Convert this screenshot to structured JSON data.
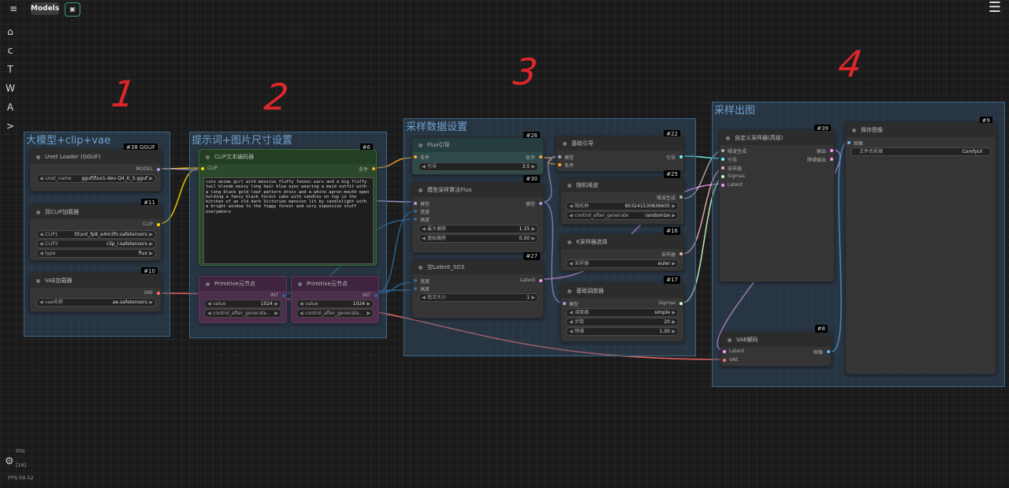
{
  "topbar": {
    "menu_label": "≡",
    "models_label": "Models",
    "queue_icon": "save-icon",
    "hamburger": "☰"
  },
  "sidebar": [
    {
      "name": "home-icon",
      "glyph": "⌂"
    },
    {
      "name": "sidebar-item-c",
      "glyph": "c"
    },
    {
      "name": "sidebar-item-t",
      "glyph": "T"
    },
    {
      "name": "sidebar-item-w",
      "glyph": "W"
    },
    {
      "name": "sidebar-item-a",
      "glyph": "A"
    },
    {
      "name": "sidebar-item-expand",
      "glyph": ">"
    }
  ],
  "annotations": [
    "1",
    "2",
    "3",
    "4"
  ],
  "groups": {
    "g1": "大模型+clip+vae",
    "g2": "提示词+图片尺寸设置",
    "g3": "采样数据设置",
    "g4": "采样出图"
  },
  "nodes": {
    "unet": {
      "title": "Unet Loader (GGUF)",
      "badge": "#38 GGUF",
      "out": "MODEL",
      "w_label": "unet_name",
      "w_value": "gguf\\flux1-dev-Q4_K_S.gguf"
    },
    "dualclip": {
      "title": "双CLIP加载器",
      "badge": "#11",
      "out": "CLIP",
      "w1_label": "CLIP1",
      "w1_value": "t5\\xxl_fp8_e4m3fn.safetensors",
      "w2_label": "CLIP2",
      "w2_value": "clip_l.safetensors",
      "w3_label": "type",
      "w3_value": "flux"
    },
    "vae": {
      "title": "VAE加载器",
      "badge": "#10",
      "out": "VAE",
      "w_label": "vae名称",
      "w_value": "ae.safetensors"
    },
    "clipenc": {
      "title": "CLIP文本编码器",
      "badge": "#6",
      "in": "CLIP",
      "out": "条件",
      "text": "cute anime girl with massive fluffy fennec ears and a big fluffy tail blonde messy long hair blue eyes wearing a maid outfit with a long black gold leaf pattern dress and a white apron mouth open holding a fancy black forest cake with candles on top in the kitchen of an old dark Victorian mansion lit by candlelight with a bright window to the foggy forest and very expensive stuff everywhere"
    },
    "prim1": {
      "title": "Primitive元节点",
      "out": "INT",
      "w1_label": "value",
      "w1_value": "1024",
      "w2_label": "control_after_generate..",
      "w2_value": ""
    },
    "prim2": {
      "title": "Primitive元节点",
      "out": "INT",
      "w1_label": "value",
      "w1_value": "1024",
      "w2_label": "control_after_generate..",
      "w2_value": ""
    },
    "fluxguide": {
      "title": "Flux引导",
      "badge": "#26",
      "in": "条件",
      "out": "条件",
      "w_label": "引导",
      "w_value": "3.5"
    },
    "modelsamp": {
      "title": "模型采样算法Flux",
      "badge": "#30",
      "in1": "模型",
      "in2": "宽度",
      "in3": "高度",
      "out": "模型",
      "w1_label": "最大偏移",
      "w1_value": "1.15",
      "w2_label": "基础偏移",
      "w2_value": "0.50"
    },
    "latent": {
      "title": "空Latent_SD3",
      "badge": "#27",
      "in1": "宽度",
      "in2": "高度",
      "out": "Latent",
      "w_label": "批次大小",
      "w_value": "1"
    },
    "basicguide": {
      "title": "基础引导",
      "badge": "#22",
      "in1": "模型",
      "in2": "条件",
      "out": "引导"
    },
    "noise": {
      "title": "随机噪波",
      "badge": "#25",
      "out": "噪波生成",
      "w1_label": "随机种",
      "w1_value": "803241530836605",
      "w2_label": "control_after_generate",
      "w2_value": "randomize"
    },
    "ksel": {
      "title": "K采样器选择",
      "badge": "#16",
      "out": "采样器",
      "w_label": "采样器",
      "w_value": "euler"
    },
    "sched": {
      "title": "基础调度器",
      "badge": "#17",
      "in": "模型",
      "out": "Sigmas",
      "w1_label": "调度器",
      "w1_value": "simple",
      "w2_label": "步数",
      "w2_value": "20",
      "w3_label": "降噪",
      "w3_value": "1.00"
    },
    "custsamp": {
      "title": "自定义采样器(高级)",
      "badge": "#39",
      "in1": "噪波生成",
      "in2": "引导",
      "in3": "采样器",
      "in4": "Sigmas",
      "in5": "Latent",
      "out1": "输出",
      "out2": "降噪输出"
    },
    "vaedec": {
      "title": "VAE解码",
      "badge": "#8",
      "in1": "Latent",
      "in2": "VAE",
      "out": "图像"
    },
    "save": {
      "title": "保存图像",
      "badge": "#9",
      "in": "图像",
      "w_label": "文件名前缀",
      "w_value": "ComfyUI"
    }
  },
  "footer": {
    "line1": "00s",
    "line2": "[16]",
    "fps": "FPS:59.52"
  },
  "colors": {
    "model": "#b39ddb",
    "clip": "#ffd500",
    "vae": "#ff6e6e",
    "conditioning": "#ffa931",
    "latent": "#ff9cf9",
    "int": "#29699c",
    "image": "#64b5f6",
    "sampler": "#ecb4b4",
    "sigmas": "#cdffcd",
    "guider": "#66ffff",
    "noise": "#b0b0b0"
  }
}
